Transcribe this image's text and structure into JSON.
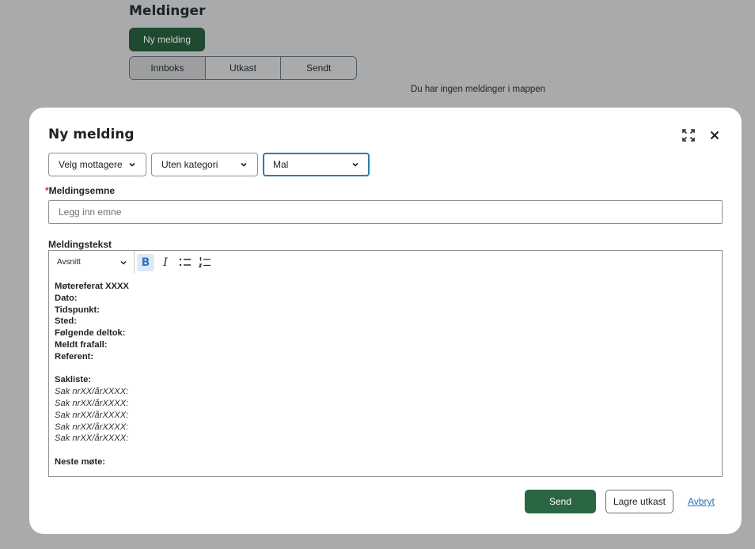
{
  "background": {
    "page_title": "Meldinger",
    "new_message_button": "Ny melding",
    "tabs": [
      {
        "label": "Innboks"
      },
      {
        "label": "Utkast"
      },
      {
        "label": "Sendt"
      }
    ],
    "empty_text": "Du har ingen meldinger i mappen"
  },
  "modal": {
    "title": "Ny melding",
    "selects": {
      "recipients": "Velg mottagere",
      "category": "Uten kategori",
      "template": "Mal"
    },
    "subject": {
      "label": "Meldingsemne",
      "required_mark": "*",
      "placeholder": "Legg inn emne",
      "value": ""
    },
    "body": {
      "label": "Meldingstekst",
      "format_select": "Avsnitt",
      "toolbar": {
        "bold": "B",
        "italic": "I"
      },
      "lines": {
        "l1": "Møtereferat XXXX",
        "l2": "Dato:",
        "l3": "Tidspunkt:",
        "l4": "Sted:",
        "l5": "Følgende deltok:",
        "l6": "Meldt frafall:",
        "l7": "Referent:",
        "l8": "Sakliste:",
        "s1": "Sak nrXX/årXXXX:",
        "s2": "Sak nrXX/årXXXX:",
        "s3": "Sak nrXX/årXXXX:",
        "s4": "Sak nrXX/årXXXX:",
        "s5": "Sak nrXX/årXXXX:",
        "l9": "Neste møte:"
      }
    },
    "actions": {
      "send": "Send",
      "save_draft": "Lagre utkast",
      "cancel": "Avbryt"
    }
  }
}
